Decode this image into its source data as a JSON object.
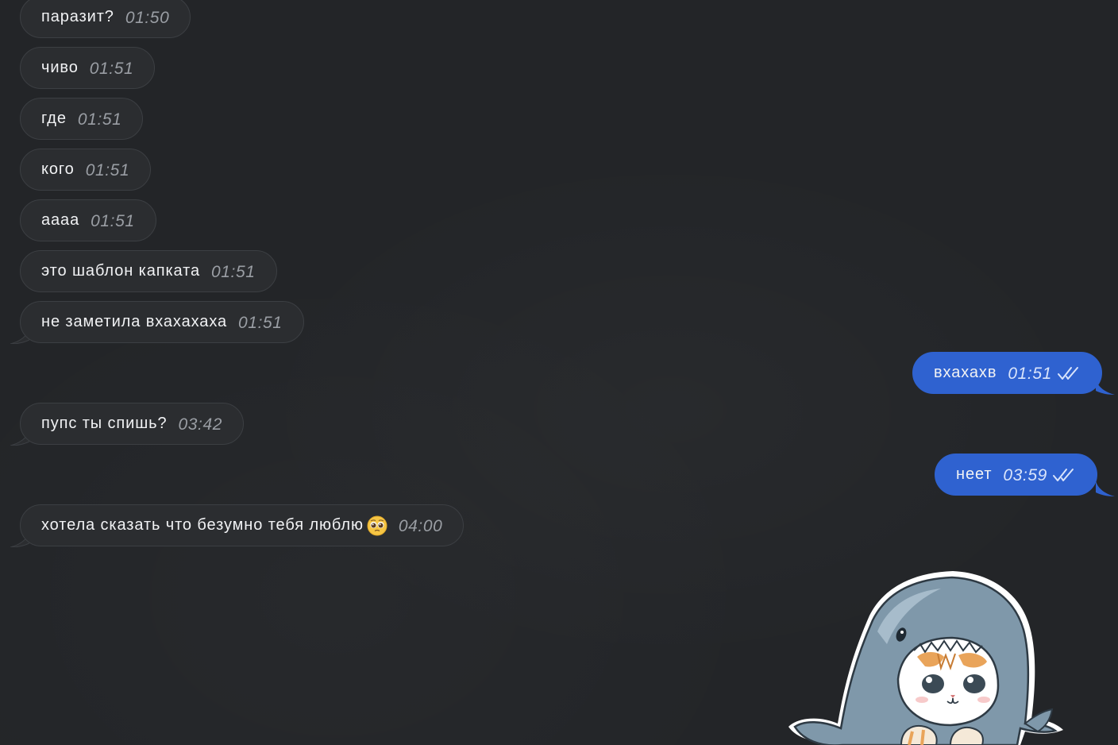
{
  "colors": {
    "background": "#232528",
    "incoming_bubble": "#2b2d30",
    "incoming_border": "#3c3f43",
    "outgoing_bubble": "#2f62d0",
    "text": "#f1f2f4",
    "incoming_time": "#9a9ea4",
    "outgoing_time": "#d9e4fb"
  },
  "messages": [
    {
      "text": "паразит?",
      "time": "01:50",
      "direction": "incoming"
    },
    {
      "text": "чиво",
      "time": "01:51",
      "direction": "incoming"
    },
    {
      "text": "где",
      "time": "01:51",
      "direction": "incoming"
    },
    {
      "text": "кого",
      "time": "01:51",
      "direction": "incoming"
    },
    {
      "text": "аааа",
      "time": "01:51",
      "direction": "incoming"
    },
    {
      "text": "это шаблон капката",
      "time": "01:51",
      "direction": "incoming"
    },
    {
      "text": "не заметила вхахахаха",
      "time": "01:51",
      "direction": "incoming"
    },
    {
      "text": "вхахахв",
      "time": "01:51",
      "direction": "outgoing",
      "status": "read"
    },
    {
      "text": "пупс ты спишь?",
      "time": "03:42",
      "direction": "incoming"
    },
    {
      "text": "неет",
      "time": "03:59",
      "direction": "outgoing",
      "status": "read"
    },
    {
      "text": "хотела сказать что безумно тебя люблю",
      "time": "04:00",
      "direction": "incoming",
      "emoji": "pleading-face-emoji"
    }
  ],
  "sticker": {
    "icon": "shark-cat-sticker"
  },
  "status_icons": {
    "read": "double-check-icon"
  }
}
